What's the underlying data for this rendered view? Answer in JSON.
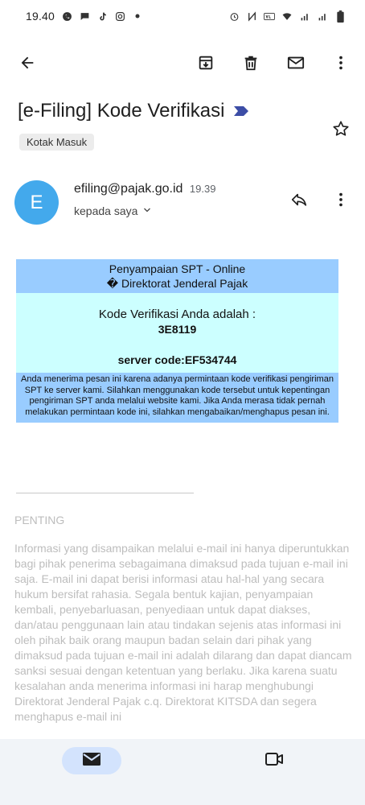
{
  "status_bar": {
    "time": "19.40",
    "left_icons": [
      "whatsapp-icon",
      "chat-bubble-icon",
      "tiktok-icon",
      "instagram-icon",
      "dot-icon"
    ],
    "right_icons": [
      "alarm-icon",
      "nfc-icon",
      "volte-icon",
      "wifi-icon",
      "signal-icon",
      "signal-icon",
      "battery-icon"
    ]
  },
  "toolbar": {
    "back_icon": "arrow-back-icon",
    "archive_icon": "archive-icon",
    "delete_icon": "trash-icon",
    "mark_unread_icon": "mail-icon",
    "more_icon": "more-vert-icon"
  },
  "email": {
    "subject": "[e-Filing] Kode Verifikasi",
    "label": "Kotak Masuk",
    "sender": "efiling@pajak.go.id",
    "time": "19.39",
    "recipient": "kepada saya",
    "avatar_letter": "E",
    "avatar_color": "#43a9ec"
  },
  "body": {
    "header_line1": "Penyampaian SPT - Online",
    "header_line2": "� Direktorat Jenderal Pajak",
    "verification_text": "Kode Verifikasi Anda adalah :",
    "verification_code": "3E8119",
    "server_code": "server code:EF534744",
    "note": "Anda menerima pesan ini karena adanya permintaan kode verifikasi pengiriman SPT ke server kami. Silahkan menggunakan kode tersebut untuk kepentingan pengiriman SPT anda melalui website kami. Jika Anda merasa tidak pernah melakukan permintaan kode ini, silahkan mengabaikan/menghapus pesan ini.",
    "header_bg": "#99ccff",
    "main_bg": "#ccffff"
  },
  "footer": {
    "penting_title": "PENTING",
    "disclaimer": "Informasi yang disampaikan melalui e-mail ini hanya diperuntukkan bagi pihak penerima sebagaimana dimaksud pada tujuan e-mail ini saja. E-mail ini dapat berisi informasi atau hal-hal yang secara hukum bersifat rahasia. Segala bentuk kajian, penyampaian kembali, penyebarluasan, penyediaan untuk dapat diakses, dan/atau penggunaan lain atau tindakan sejenis atas informasi ini oleh pihak baik orang maupun badan selain dari pihak yang dimaksud pada tujuan e-mail ini adalah dilarang dan dapat diancam sanksi sesuai dengan ketentuan yang berlaku. Jika karena suatu kesalahan anda menerima informasi ini harap menghubungi Direktorat Jenderal Pajak c.q. Direktorat KITSDA dan segera menghapus e-mail ini"
  },
  "bottom_nav": {
    "mail_icon": "mail-icon",
    "meet_icon": "video-camera-icon"
  }
}
